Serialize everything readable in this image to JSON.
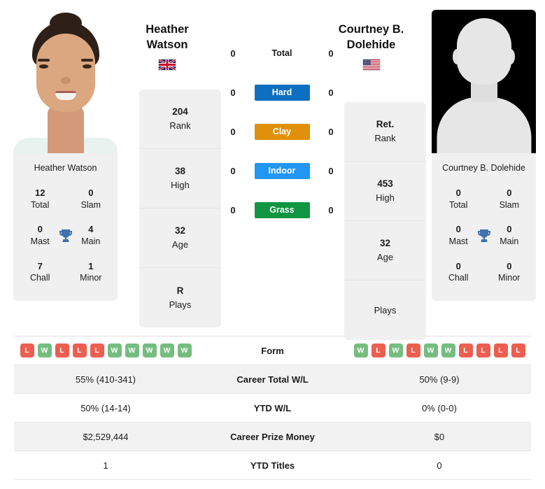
{
  "players": {
    "left": {
      "name": "Heather Watson",
      "name_line1": "Heather",
      "name_line2": "Watson",
      "flag": "gb-flag",
      "photo_caption": "Heather Watson",
      "titles": {
        "total_value": "12",
        "total_label": "Total",
        "slam_value": "0",
        "slam_label": "Slam",
        "mast_value": "0",
        "mast_label": "Mast",
        "main_value": "4",
        "main_label": "Main",
        "chall_value": "7",
        "chall_label": "Chall",
        "minor_value": "1",
        "minor_label": "Minor"
      },
      "profile": {
        "rank_value": "204",
        "rank_label": "Rank",
        "high_value": "38",
        "high_label": "High",
        "age_value": "32",
        "age_label": "Age",
        "plays_value": "R",
        "plays_label": "Plays"
      }
    },
    "right": {
      "name": "Courtney B. Dolehide",
      "name_line1": "Courtney B.",
      "name_line2": "Dolehide",
      "flag": "us-flag",
      "photo_caption": "Courtney B. Dolehide",
      "titles": {
        "total_value": "0",
        "total_label": "Total",
        "slam_value": "0",
        "slam_label": "Slam",
        "mast_value": "0",
        "mast_label": "Mast",
        "main_value": "0",
        "main_label": "Main",
        "chall_value": "0",
        "chall_label": "Chall",
        "minor_value": "0",
        "minor_label": "Minor"
      },
      "profile": {
        "rank_value": "Ret.",
        "rank_label": "Rank",
        "high_value": "453",
        "high_label": "High",
        "age_value": "32",
        "age_label": "Age",
        "plays_value": "",
        "plays_label": "Plays"
      }
    }
  },
  "surfaces": [
    {
      "label": "Total",
      "left": "0",
      "right": "0",
      "color": "transparent"
    },
    {
      "label": "Hard",
      "left": "0",
      "right": "0",
      "color": "#0d6fc0"
    },
    {
      "label": "Clay",
      "left": "0",
      "right": "0",
      "color": "#e0900b"
    },
    {
      "label": "Indoor",
      "left": "0",
      "right": "0",
      "color": "#2196f3"
    },
    {
      "label": "Grass",
      "left": "0",
      "right": "0",
      "color": "#109641"
    }
  ],
  "table": {
    "form": {
      "label": "Form",
      "left": [
        "L",
        "W",
        "L",
        "L",
        "L",
        "W",
        "W",
        "W",
        "W",
        "W"
      ],
      "right": [
        "W",
        "L",
        "W",
        "L",
        "W",
        "W",
        "L",
        "L",
        "L",
        "L"
      ]
    },
    "rows": [
      {
        "label": "Career Total W/L",
        "left": "55% (410-341)",
        "right": "50% (9-9)"
      },
      {
        "label": "YTD W/L",
        "left": "50% (14-14)",
        "right": "0% (0-0)"
      },
      {
        "label": "Career Prize Money",
        "left": "$2,529,444",
        "right": "$0"
      },
      {
        "label": "YTD Titles",
        "left": "1",
        "right": "0"
      }
    ]
  },
  "colors": {
    "win": "#75bd7f",
    "loss": "#ec5e4f",
    "trophy": "#3f72ad",
    "card_bg": "#f0f0f0"
  }
}
